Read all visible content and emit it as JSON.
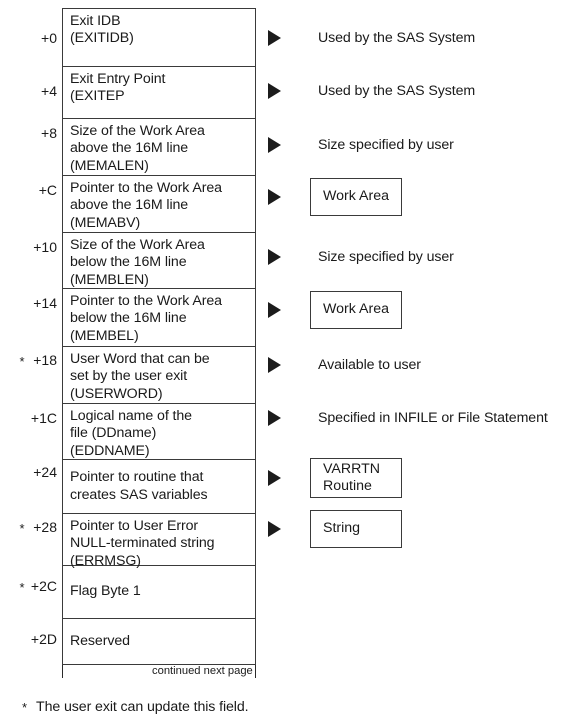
{
  "diagram": {
    "title": "SAS user exit control block layout",
    "accent_color": "#3a3a3a",
    "arrow_color": "#1c1c1c",
    "background": "#ffffff",
    "rows": [
      {
        "offset": "+0",
        "star": "",
        "lines": [
          "Exit IDB",
          "(EXITIDB)"
        ],
        "annotation_type": "text",
        "annotation": "Used by the SAS System",
        "annotation_lines": [
          "Used by the SAS System"
        ]
      },
      {
        "offset": "+4",
        "star": "",
        "lines": [
          "Exit Entry Point",
          "(EXITEP"
        ],
        "annotation_type": "text",
        "annotation": "Used by the SAS System",
        "annotation_lines": [
          "Used by the SAS System"
        ]
      },
      {
        "offset": "+8",
        "star": "",
        "lines": [
          "Size of the Work Area",
          "above the 16M line",
          "(MEMALEN)"
        ],
        "annotation_type": "text",
        "annotation": "Size specified by user",
        "annotation_lines": [
          "Size specified by user"
        ]
      },
      {
        "offset": "+C",
        "star": "",
        "lines": [
          "Pointer to the Work Area",
          "above the 16M line",
          "(MEMABV)"
        ],
        "annotation_type": "box",
        "annotation": "Work Area",
        "annotation_lines": [
          "Work Area"
        ]
      },
      {
        "offset": "+10",
        "star": "",
        "lines": [
          "Size of the Work Area",
          "below the 16M line",
          "(MEMBLEN)"
        ],
        "annotation_type": "text",
        "annotation": "Size specified by user",
        "annotation_lines": [
          "Size specified by user"
        ]
      },
      {
        "offset": "+14",
        "star": "",
        "lines": [
          "Pointer to the Work Area",
          "below the 16M line",
          "(MEMBEL)"
        ],
        "annotation_type": "box",
        "annotation": "Work Area",
        "annotation_lines": [
          "Work Area"
        ]
      },
      {
        "offset": "+18",
        "star": "*",
        "lines": [
          "User Word that can be",
          "set by the user exit",
          "(USERWORD)"
        ],
        "annotation_type": "text",
        "annotation": "Available to user",
        "annotation_lines": [
          "Available to user"
        ]
      },
      {
        "offset": "+1C",
        "star": "",
        "lines": [
          "Logical name of the",
          "file (DDname)",
          "(EDDNAME)"
        ],
        "annotation_type": "text",
        "annotation": "Specified in INFILE or File Statement",
        "annotation_lines": [
          "Specified in INFILE or File Statement"
        ]
      },
      {
        "offset": "+24",
        "star": "",
        "lines": [
          "Pointer to routine that",
          "creates SAS variables"
        ],
        "annotation_type": "box",
        "annotation": "VARRTN Routine",
        "annotation_lines": [
          "VARRTN",
          "Routine"
        ]
      },
      {
        "offset": "+28",
        "star": "*",
        "lines": [
          "Pointer to User Error",
          "NULL-terminated string",
          "(ERRMSG)"
        ],
        "annotation_type": "box",
        "annotation": "String",
        "annotation_lines": [
          "String"
        ]
      },
      {
        "offset": "+2C",
        "star": "*",
        "lines": [
          "Flag Byte 1"
        ],
        "annotation_type": "none",
        "annotation": "",
        "annotation_lines": []
      },
      {
        "offset": "+2D",
        "star": "",
        "lines": [
          "Reserved"
        ],
        "annotation_type": "none",
        "annotation": "",
        "annotation_lines": []
      }
    ],
    "continuation": "continued next page",
    "footnote": {
      "marker": "*",
      "text": "The user exit can update this field."
    }
  }
}
